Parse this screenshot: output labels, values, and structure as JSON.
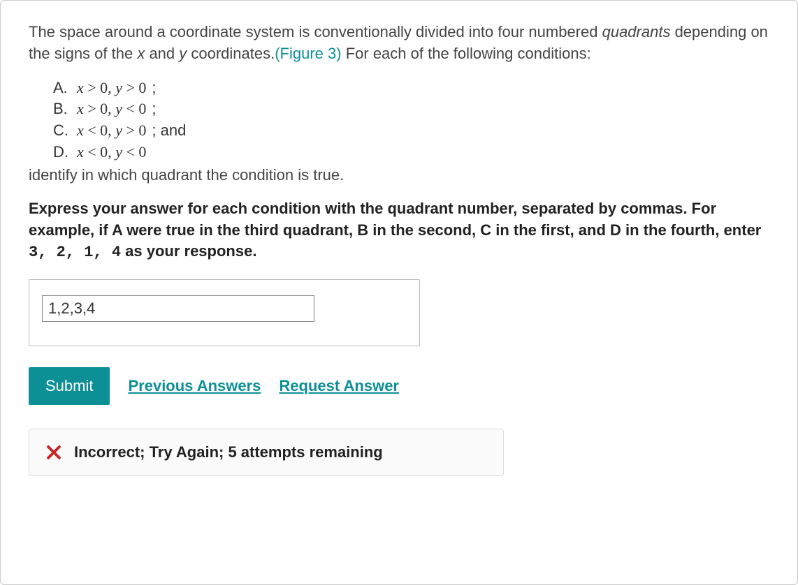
{
  "intro": {
    "text1": "The space around a coordinate system is conventionally divided into four numbered ",
    "quadrants": "quadrants",
    "text2": " depending on the signs of the ",
    "x": "x",
    "and": " and ",
    "y": "y",
    "text3": " coordinates.",
    "figure_link": "(Figure 3)",
    "text4": " For each of the following conditions:"
  },
  "conditions": {
    "A": {
      "letter": "A.",
      "math": "<span class='mi'>x</span> &gt; 0, <span class='mi'>y</span> &gt; 0",
      "suffix": ";"
    },
    "B": {
      "letter": "B.",
      "math": "<span class='mi'>x</span> &gt; 0, <span class='mi'>y</span> &lt; 0",
      "suffix": ";"
    },
    "C": {
      "letter": "C.",
      "math": "<span class='mi'>x</span> &lt; 0, <span class='mi'>y</span> &gt; 0",
      "suffix": "; and"
    },
    "D": {
      "letter": "D.",
      "math": "<span class='mi'>x</span> &lt; 0, <span class='mi'>y</span> &lt; 0",
      "suffix": ""
    }
  },
  "identify": "identify in which quadrant the condition is true.",
  "instruction": {
    "part1": "Express your answer for each condition with the quadrant number, separated by commas. For example, if A were true in the third quadrant, B in the second, C in the first, and D in the fourth, enter ",
    "mono": "3, 2, 1, 4",
    "part2": " as your response."
  },
  "answer_value": "1,2,3,4",
  "buttons": {
    "submit": "Submit",
    "previous": "Previous Answers",
    "request": "Request Answer"
  },
  "feedback": "Incorrect; Try Again; 5 attempts remaining"
}
